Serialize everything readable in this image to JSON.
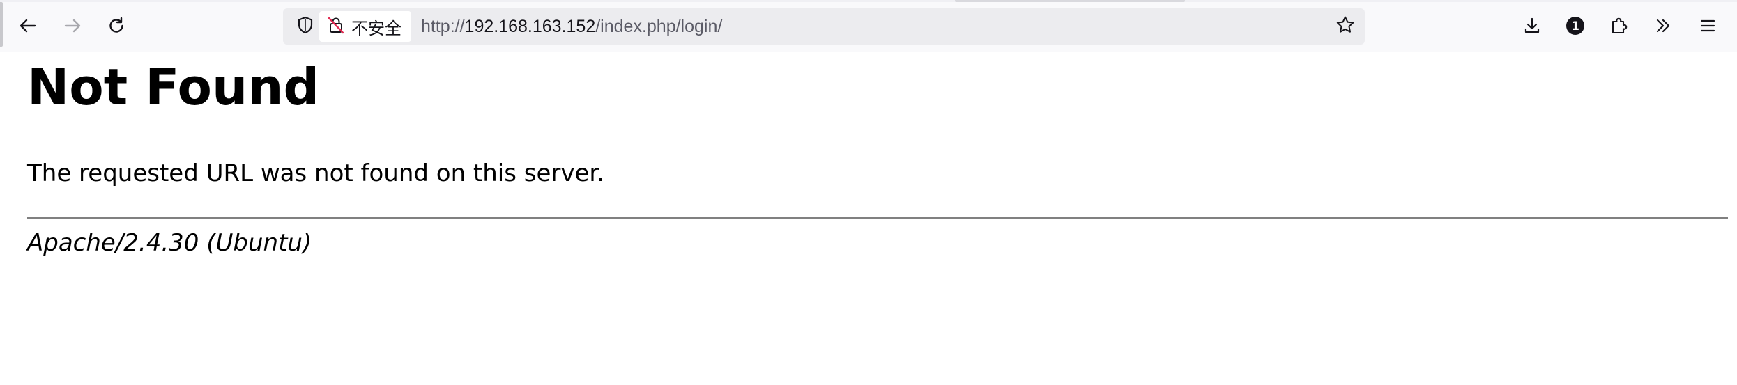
{
  "browser": {
    "urlbar": {
      "security_label": "不安全",
      "url_scheme": "http://",
      "url_host": "192.168.163.152",
      "url_path": "/index.php/login/"
    },
    "toolbar": {
      "extensions_badge_count": "1"
    },
    "colors": {
      "insecure_icon": "#e22850",
      "toolbar_bg": "#f9f9fb",
      "urlbar_bg": "#ececef"
    },
    "icons": {
      "back": "back-arrow-icon",
      "forward": "forward-arrow-icon",
      "reload": "reload-icon",
      "tracking_protection": "shield-icon",
      "insecure": "insecure-lock-icon",
      "bookmark": "star-icon",
      "downloads": "download-icon",
      "account": "account-badge-icon",
      "extensions": "puzzle-icon",
      "overflow": "chevron-double-right-icon",
      "menu": "hamburger-menu-icon"
    }
  },
  "page": {
    "title": "Not Found",
    "message": "The requested URL was not found on this server.",
    "server_signature": "Apache/2.4.30 (Ubuntu)"
  }
}
